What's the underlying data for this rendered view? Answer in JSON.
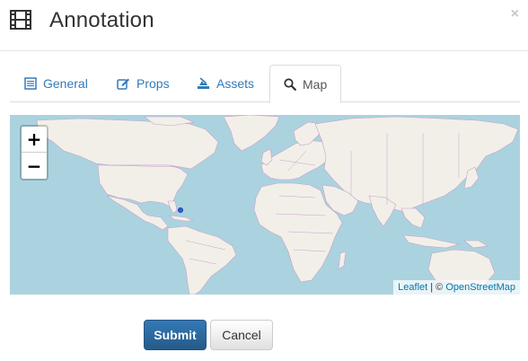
{
  "dialog": {
    "title": "Annotation",
    "close_symbol": "×",
    "title_icon": "film-icon",
    "close_icon": "close-icon"
  },
  "tabs": [
    {
      "label": "General",
      "icon": "list-icon",
      "active": false
    },
    {
      "label": "Props",
      "icon": "edit-icon",
      "active": false
    },
    {
      "label": "Assets",
      "icon": "assets-icon",
      "active": false
    },
    {
      "label": "Map",
      "icon": "search-icon",
      "active": true
    }
  ],
  "map": {
    "zoom_in": "+",
    "zoom_out": "−",
    "attribution_leaflet": "Leaflet",
    "attribution_separator": " | © ",
    "attribution_osm": "OpenStreetMap",
    "marker_icon": "location-marker",
    "ocean_color": "#aad3df",
    "land_color": "#f2efe9",
    "border_color": "#c9a0c8"
  },
  "actions": {
    "submit_label": "Submit",
    "cancel_label": "Cancel"
  },
  "colors": {
    "link": "#337ab7",
    "primary": "#2e6da4"
  }
}
